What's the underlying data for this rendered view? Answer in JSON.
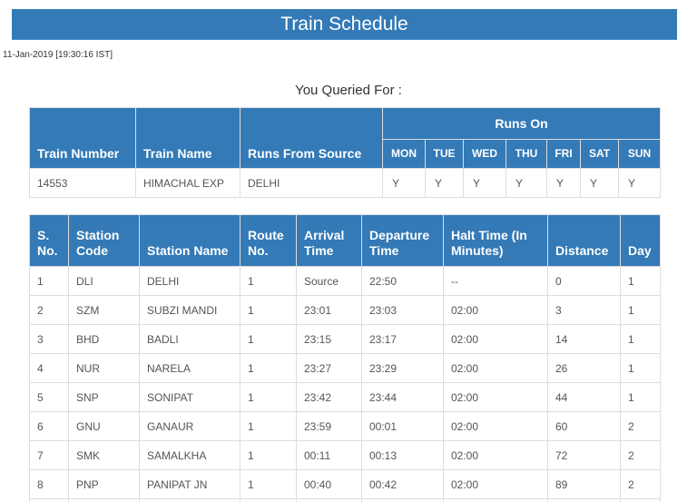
{
  "header": {
    "title": "Train Schedule",
    "timestamp": "11-Jan-2019 [19:30:16 IST]",
    "queried_label": "You Queried For :"
  },
  "colors": {
    "accent": "#337ab7",
    "border": "#dddddd",
    "text": "#555555"
  },
  "train_info": {
    "headers": {
      "train_number": "Train Number",
      "train_name": "Train Name",
      "runs_from_source": "Runs From Source",
      "runs_on": "Runs On",
      "days": [
        "MON",
        "TUE",
        "WED",
        "THU",
        "FRI",
        "SAT",
        "SUN"
      ]
    },
    "row": {
      "train_number": "14553",
      "train_name": "HIMACHAL EXP",
      "runs_from_source": "DELHI",
      "days": [
        "Y",
        "Y",
        "Y",
        "Y",
        "Y",
        "Y",
        "Y"
      ]
    }
  },
  "route": {
    "headers": [
      "S. No.",
      "Station Code",
      "Station Name",
      "Route No.",
      "Arrival Time",
      "Departure Time",
      "Halt Time (In Minutes)",
      "Distance",
      "Day"
    ],
    "rows": [
      [
        "1",
        "DLI",
        "DELHI",
        "1",
        "Source",
        "22:50",
        "--",
        "0",
        "1"
      ],
      [
        "2",
        "SZM",
        "SUBZI MANDI",
        "1",
        "23:01",
        "23:03",
        "02:00",
        "3",
        "1"
      ],
      [
        "3",
        "BHD",
        "BADLI",
        "1",
        "23:15",
        "23:17",
        "02:00",
        "14",
        "1"
      ],
      [
        "4",
        "NUR",
        "NARELA",
        "1",
        "23:27",
        "23:29",
        "02:00",
        "26",
        "1"
      ],
      [
        "5",
        "SNP",
        "SONIPAT",
        "1",
        "23:42",
        "23:44",
        "02:00",
        "44",
        "1"
      ],
      [
        "6",
        "GNU",
        "GANAUR",
        "1",
        "23:59",
        "00:01",
        "02:00",
        "60",
        "2"
      ],
      [
        "7",
        "SMK",
        "SAMALKHA",
        "1",
        "00:11",
        "00:13",
        "02:00",
        "72",
        "2"
      ],
      [
        "8",
        "PNP",
        "PANIPAT JN",
        "1",
        "00:40",
        "00:42",
        "02:00",
        "89",
        "2"
      ]
    ]
  }
}
